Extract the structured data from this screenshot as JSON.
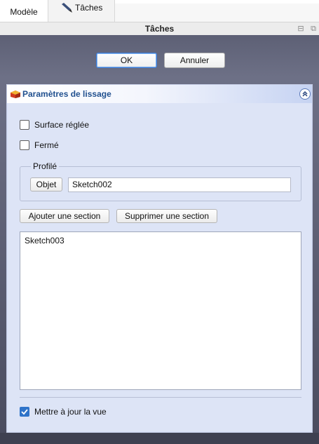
{
  "tabs": [
    {
      "label": "Modèle"
    },
    {
      "label": "Tâches"
    }
  ],
  "titlebar": {
    "title": "Tâches"
  },
  "dialog": {
    "ok_label": "OK",
    "cancel_label": "Annuler"
  },
  "taskbox": {
    "title": "Paramètres de lissage",
    "ruled_surface": {
      "label": "Surface réglée",
      "checked": false
    },
    "closed": {
      "label": "Fermé",
      "checked": false
    },
    "profile": {
      "group_label": "Profilé",
      "object_button": "Objet",
      "value": "Sketch002"
    },
    "add_section_label": "Ajouter une section",
    "remove_section_label": "Supprimer une section",
    "sections": [
      "Sketch003"
    ],
    "update_view": {
      "label": "Mettre à jour la vue",
      "checked": true
    }
  },
  "colors": {
    "accent": "#2f73c9",
    "header_text": "#21508f",
    "panel_bg": "#5d6075"
  },
  "icons": {
    "tasks_tab": "pencil-icon",
    "taskbox": "loft-cube-icon",
    "collapse": "chevron-up-double-icon"
  }
}
